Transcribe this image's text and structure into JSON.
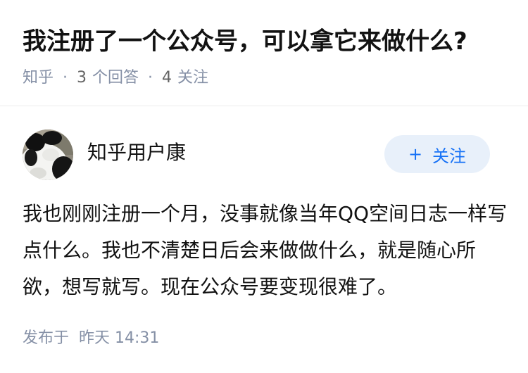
{
  "question": {
    "title": "我注册了一个公众号，可以拿它来做什么?",
    "source": "知乎",
    "answer_count": "3",
    "answer_label": "个回答",
    "follow_count": "4",
    "follow_label": "关注"
  },
  "answer": {
    "author_name": "知乎用户康",
    "follow_button_label": "关注",
    "content": "我也刚刚注册一个月，没事就像当年QQ空间日志一样写点什么。我也不清楚日后会来做做什么，就是随心所欲，想写就写。现在公众号要变现很难了。",
    "published_label": "发布于",
    "published_time": "昨天 14:31"
  },
  "icons": {
    "follow_icon": "plus-icon",
    "avatar": "panda-avatar"
  },
  "colors": {
    "title": "#121212",
    "meta": "#8590a6",
    "accent": "#1772f6",
    "follow_bg": "#e8f0fa"
  }
}
